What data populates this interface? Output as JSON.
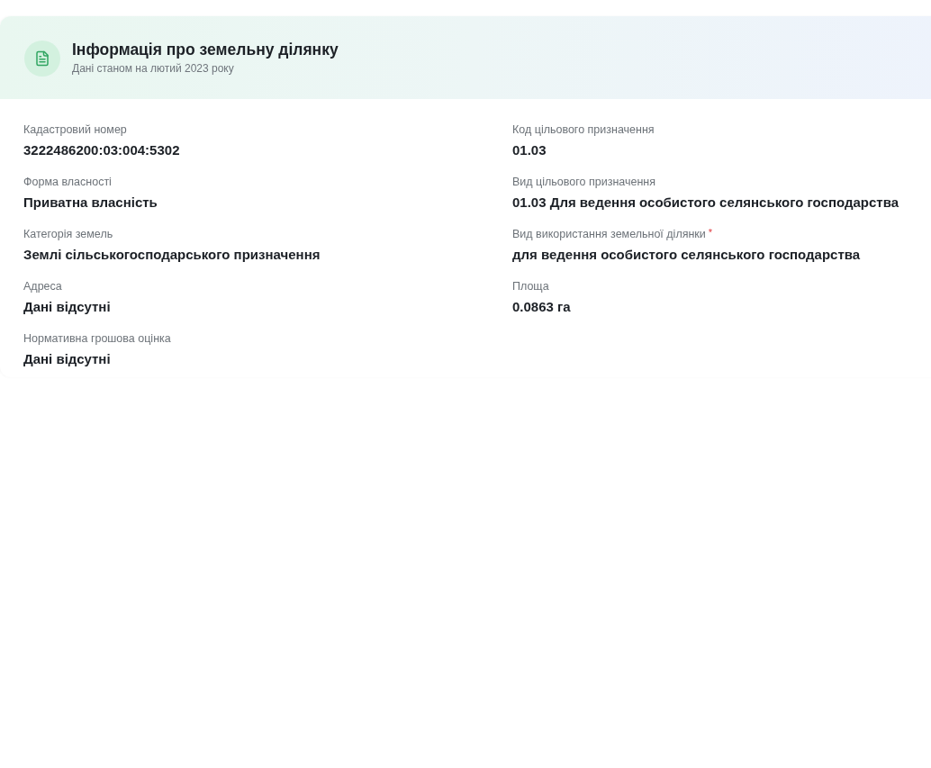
{
  "header": {
    "title": "Інформація про земельну ділянку",
    "subtitle": "Дані станом на лютий 2023 року"
  },
  "columns": [
    {
      "fields": [
        {
          "label": "Кадастровий номер",
          "value": "3222486200:03:004:5302"
        },
        {
          "label": "Форма власності",
          "value": "Приватна власність"
        },
        {
          "label": "Категорія земель",
          "value": "Землі сільськогосподарського призначення"
        },
        {
          "label": "Адреса",
          "value": "Дані відсутні"
        },
        {
          "label": "Нормативна грошова оцінка",
          "value": "Дані відсутні"
        }
      ]
    },
    {
      "fields": [
        {
          "label": "Код цільового призначення",
          "value": "01.03"
        },
        {
          "label": "Вид цільового призначення",
          "value": "01.03 Для ведення особистого селянського господарства"
        },
        {
          "label": "Вид використання земельної ділянки",
          "required_mark": "*",
          "value": "для ведення особистого селянського господарства"
        },
        {
          "label": "Площа",
          "value": "0.0863 га"
        }
      ]
    }
  ]
}
